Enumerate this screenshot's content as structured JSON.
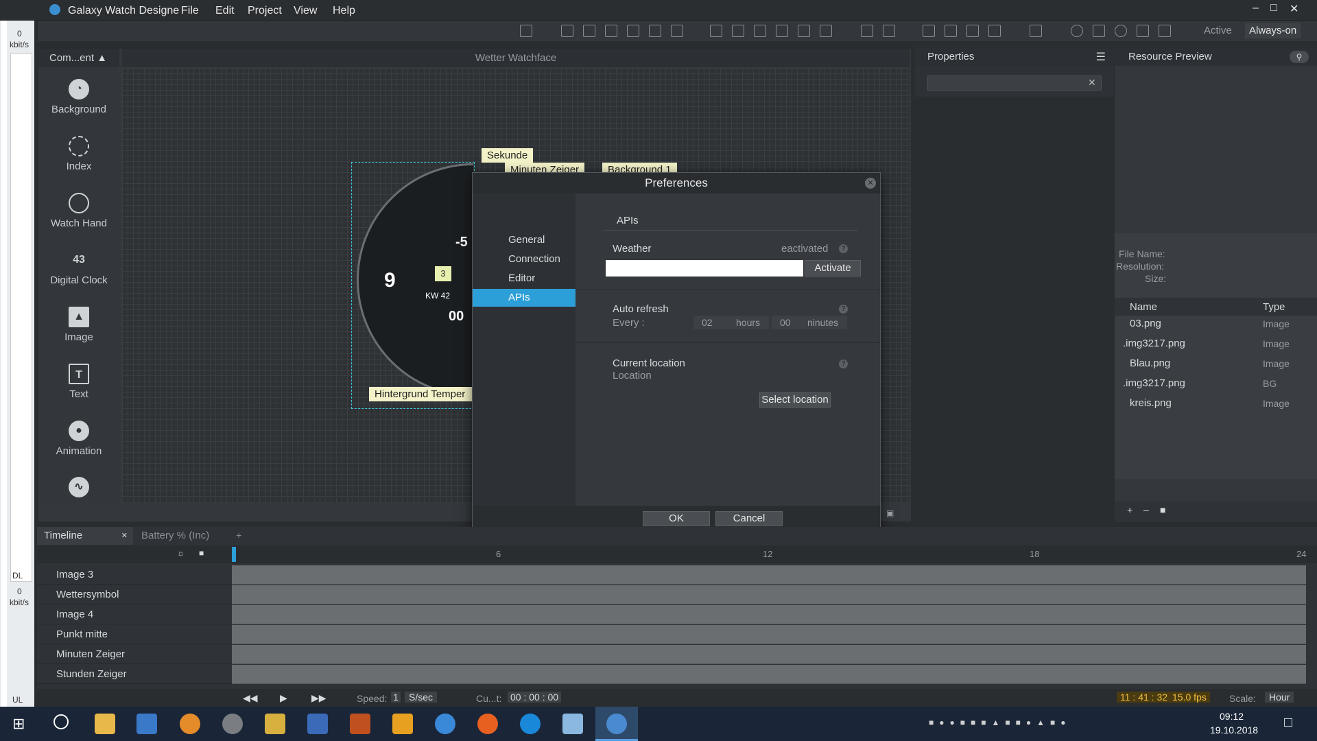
{
  "app": {
    "title": "Galaxy Watch Designe",
    "menu": [
      "File",
      "Edit",
      "Project",
      "View",
      "Help"
    ],
    "mode_active": "Active",
    "mode_always": "Always-on",
    "colors": {
      "accent": "#2d9fd8",
      "bg": "#2a2d30"
    }
  },
  "leftstrip": {
    "top_value": "0",
    "top_unit": "kbit/s",
    "dl": "DL",
    "mid_value": "0",
    "mid_unit": "kbit/s",
    "ul": "UL"
  },
  "components": {
    "header": "Com...ent",
    "items": [
      {
        "label": "Background",
        "icon": "clock-icon"
      },
      {
        "label": "Index",
        "icon": "index-icon"
      },
      {
        "label": "Watch Hand",
        "icon": "watch-hand-icon"
      },
      {
        "label": "Digital Clock",
        "icon": "digital-clock-icon"
      },
      {
        "label": "Image",
        "icon": "image-icon"
      },
      {
        "label": "Text",
        "icon": "text-icon"
      },
      {
        "label": "Animation",
        "icon": "animation-icon"
      }
    ]
  },
  "canvas": {
    "title": "Wetter Watchface",
    "labels": {
      "sekunde": "Sekunde",
      "minuten": "Minuten Zeiger",
      "background": "Background 1",
      "hintergrund": "Hintergrund Temper",
      "num9": "9",
      "num3": "3",
      "kw": "KW 42",
      "m5": "-5",
      "oo": "00"
    }
  },
  "properties": {
    "header": "Properties"
  },
  "resources": {
    "header": "Resource Preview",
    "file_name": "File Name:",
    "resolution": "Resolution:",
    "size": "Size:",
    "col_name": "Name",
    "col_type": "Type",
    "rows": [
      {
        "name": "03.png",
        "type": "Image"
      },
      {
        "name": ".img3217.png",
        "type": "Image"
      },
      {
        "name": "Blau.png",
        "type": "Image"
      },
      {
        "name": ".img3217.png",
        "type": "BG"
      },
      {
        "name": "kreis.png",
        "type": "Image"
      }
    ]
  },
  "dialog": {
    "title": "Preferences",
    "nav": [
      "General",
      "Connection",
      "Editor",
      "APIs"
    ],
    "section": "APIs",
    "weather_label": "Weather",
    "weather_status": "eactivated",
    "activate": "Activate",
    "auto_refresh": "Auto refresh",
    "every": "Every :",
    "hours_value": "02",
    "hours_label": "hours",
    "minutes_value": "00",
    "minutes_label": "ninutes",
    "current_location": "Current location",
    "location": "Location",
    "select_location": "Select location",
    "ok": "OK",
    "cancel": "Cancel"
  },
  "timeline": {
    "tab1": "Timeline",
    "tab2": "Battery % (Inc)",
    "ticks": [
      "6",
      "12",
      "18",
      "24"
    ],
    "layers": [
      "Image 3",
      "Wettersymbol",
      "Image 4",
      "Punkt mitte",
      "Minuten Zeiger",
      "Stunden Zeiger"
    ],
    "speed_label": "Speed:",
    "speed_value": "1",
    "speed_unit": "S/sec",
    "cur_label": "Cu...t:",
    "cur_value": "00 : 00 : 00",
    "clock": "11 : 41 : 32",
    "fps": "15.0 fps",
    "scale_label": "Scale:",
    "scale_value": "Hour"
  },
  "taskbar": {
    "time": "09:12",
    "date": "19.10.2018"
  }
}
